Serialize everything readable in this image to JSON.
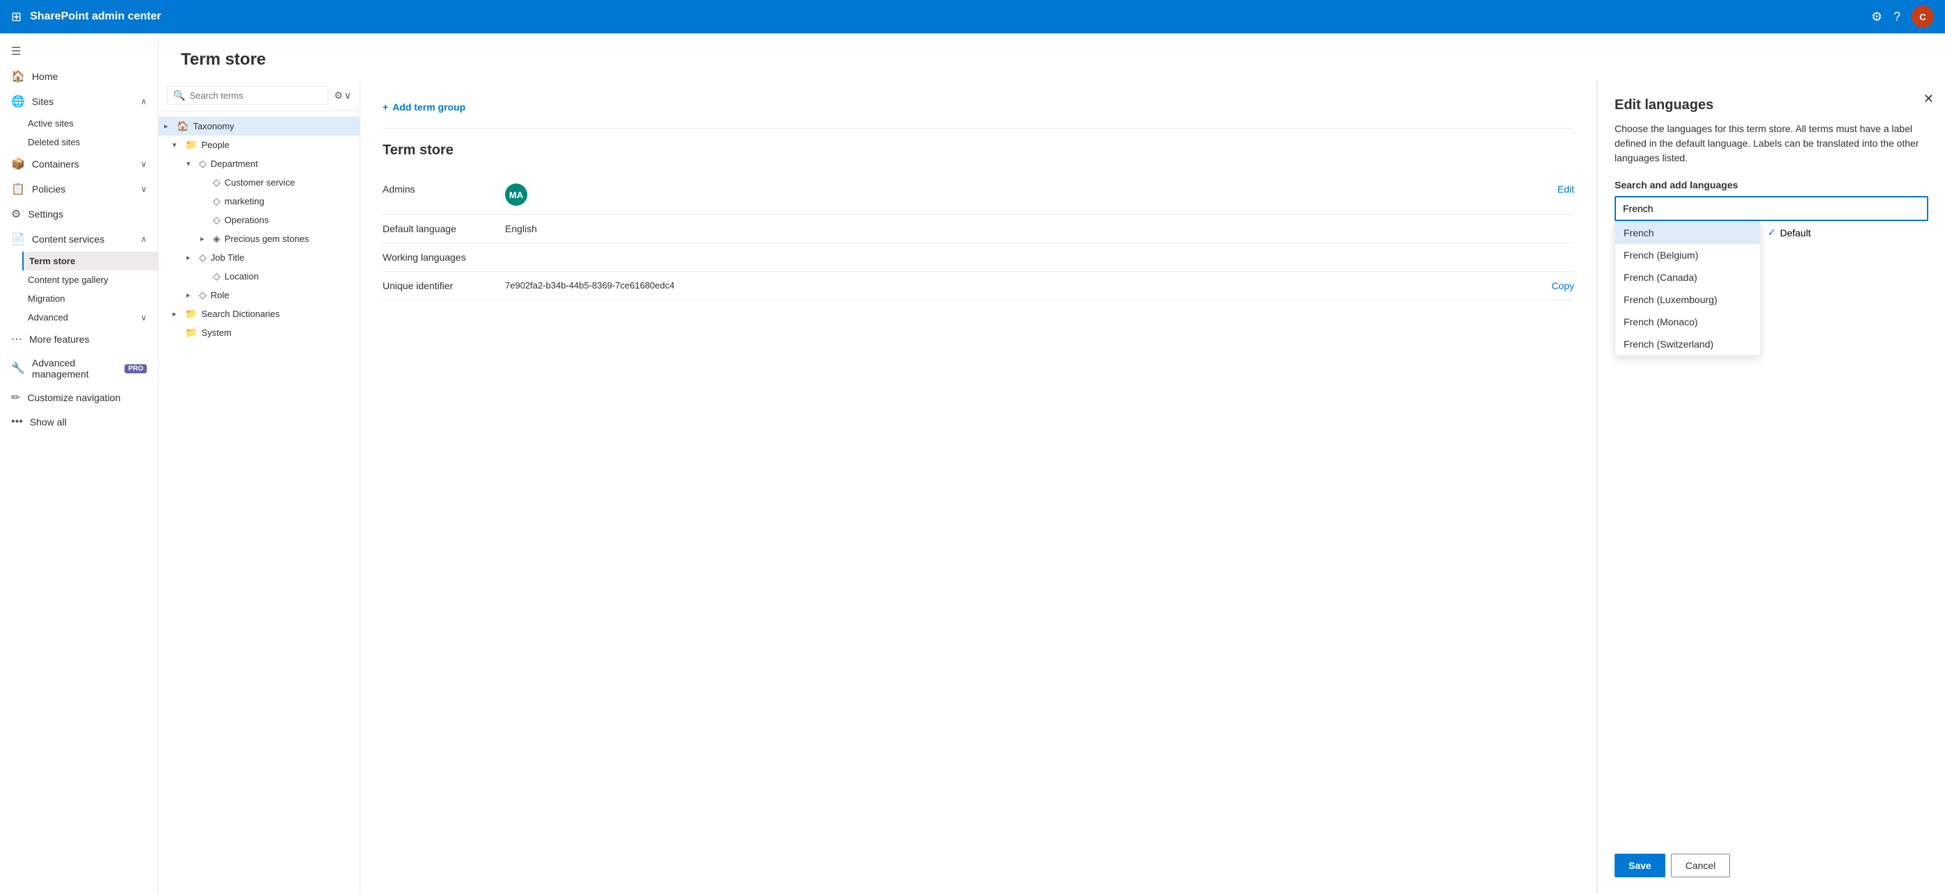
{
  "app": {
    "title": "SharePoint admin center",
    "waffle_icon": "⊞",
    "gear_label": "⚙",
    "help_label": "?",
    "avatar_initials": "C"
  },
  "sidebar": {
    "hamburger": "☰",
    "items": [
      {
        "id": "home",
        "label": "Home",
        "icon": "🏠",
        "indent": 0
      },
      {
        "id": "sites",
        "label": "Sites",
        "icon": "🌐",
        "indent": 0,
        "chevron": "∧"
      },
      {
        "id": "active-sites",
        "label": "Active sites",
        "icon": "",
        "indent": 1
      },
      {
        "id": "deleted-sites",
        "label": "Deleted sites",
        "icon": "",
        "indent": 1
      },
      {
        "id": "containers",
        "label": "Containers",
        "icon": "📦",
        "indent": 0,
        "chevron": "∨"
      },
      {
        "id": "policies",
        "label": "Policies",
        "icon": "📋",
        "indent": 0,
        "chevron": "∨"
      },
      {
        "id": "settings",
        "label": "Settings",
        "icon": "⚙",
        "indent": 0
      },
      {
        "id": "content-services",
        "label": "Content services",
        "icon": "📄",
        "indent": 0,
        "chevron": "∧"
      },
      {
        "id": "term-store",
        "label": "Term store",
        "icon": "",
        "indent": 1,
        "active": true
      },
      {
        "id": "content-type-gallery",
        "label": "Content type gallery",
        "icon": "",
        "indent": 1
      },
      {
        "id": "migration",
        "label": "Migration",
        "icon": "",
        "indent": 1
      },
      {
        "id": "advanced",
        "label": "Advanced",
        "icon": "",
        "indent": 1,
        "chevron": "∨"
      },
      {
        "id": "more-features",
        "label": "More features",
        "icon": "…",
        "indent": 0
      },
      {
        "id": "advanced-management",
        "label": "Advanced management",
        "icon": "🔧",
        "indent": 0,
        "pro": true
      },
      {
        "id": "customize-navigation",
        "label": "Customize navigation",
        "icon": "✏",
        "indent": 0
      },
      {
        "id": "show-all",
        "label": "Show all",
        "icon": "•••",
        "indent": 0
      }
    ]
  },
  "page": {
    "title": "Term store"
  },
  "toolbar": {
    "search_placeholder": "Search terms",
    "add_term_group_label": "Add term group"
  },
  "taxonomy_tree": {
    "items": [
      {
        "id": "taxonomy",
        "label": "Taxonomy",
        "icon": "🏠",
        "indent": 0,
        "chevron": "▸",
        "more": "⋯",
        "selected": true
      },
      {
        "id": "people",
        "label": "People",
        "icon": "📁",
        "indent": 1,
        "chevron": "▾",
        "more": "⋯"
      },
      {
        "id": "department",
        "label": "Department",
        "icon": "◇",
        "indent": 2,
        "chevron": "▾"
      },
      {
        "id": "customer-service",
        "label": "Customer service",
        "icon": "◇",
        "indent": 3
      },
      {
        "id": "marketing",
        "label": "marketing",
        "icon": "◇",
        "indent": 3
      },
      {
        "id": "operations",
        "label": "Operations",
        "icon": "◇",
        "indent": 3
      },
      {
        "id": "precious-gem-stones",
        "label": "Precious gem stones",
        "icon": "◈",
        "indent": 3,
        "chevron": "▸"
      },
      {
        "id": "job-title",
        "label": "Job Title",
        "icon": "◇",
        "indent": 2,
        "chevron": "▸"
      },
      {
        "id": "location",
        "label": "Location",
        "icon": "◇",
        "indent": 3
      },
      {
        "id": "role",
        "label": "Role",
        "icon": "◇",
        "indent": 2,
        "chevron": "▸"
      },
      {
        "id": "search-dictionaries",
        "label": "Search Dictionaries",
        "icon": "📁",
        "indent": 1,
        "chevron": "▸",
        "more": "⋯"
      },
      {
        "id": "system",
        "label": "System",
        "icon": "📁",
        "indent": 1,
        "chevron": "",
        "more": "✕"
      }
    ]
  },
  "term_store_info": {
    "title": "Term store",
    "admins_label": "Admins",
    "admins_edit": "Edit",
    "admin_initials": "MA",
    "default_lang_label": "Default language",
    "default_lang_value": "English",
    "working_lang_label": "Working languages",
    "unique_id_label": "Unique identifier",
    "unique_id_value": "7e902fa2-b34b-44b5-8369-7ce61680edc4",
    "unique_id_copy": "Copy"
  },
  "edit_languages_panel": {
    "title": "Edit languages",
    "description": "Choose the languages for this term store. All terms must have a label defined in the default language. Labels can be translated into the other languages listed.",
    "search_subtitle": "Search and add languages",
    "search_value": "French",
    "dropdown_options": [
      {
        "id": "french",
        "label": "French",
        "highlighted": true
      },
      {
        "id": "french-belgium",
        "label": "French (Belgium)",
        "highlighted": false
      },
      {
        "id": "french-canada",
        "label": "French (Canada)",
        "highlighted": false
      },
      {
        "id": "french-luxembourg",
        "label": "French (Luxembourg)",
        "highlighted": false
      },
      {
        "id": "french-monaco",
        "label": "French (Monaco)",
        "highlighted": false
      },
      {
        "id": "french-switzerland",
        "label": "French (Switzerland)",
        "highlighted": false
      }
    ],
    "default_check": "✓",
    "default_label": "Default",
    "save_label": "Save",
    "cancel_label": "Cancel",
    "close_icon": "✕"
  }
}
